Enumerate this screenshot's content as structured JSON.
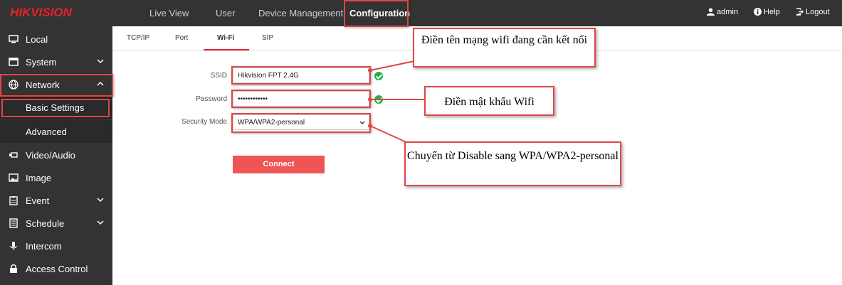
{
  "brand": {
    "logo_text": "HIKVISION",
    "accent": "#e6212a"
  },
  "topnav": {
    "items": [
      {
        "label": "Live View"
      },
      {
        "label": "User"
      },
      {
        "label": "Device Management"
      },
      {
        "label": "Configuration",
        "active": true
      }
    ],
    "right": [
      {
        "label": "admin",
        "icon": "user-icon"
      },
      {
        "label": "Help",
        "icon": "info-icon"
      },
      {
        "label": "Logout",
        "icon": "logout-icon"
      }
    ]
  },
  "sidebar": {
    "items": [
      {
        "label": "Local",
        "icon": "monitor-icon"
      },
      {
        "label": "System",
        "icon": "window-icon"
      },
      {
        "label": "Network",
        "icon": "globe-icon",
        "expanded": true
      },
      {
        "label": "Basic Settings",
        "sub": true,
        "selected": true
      },
      {
        "label": "Advanced",
        "sub": true
      },
      {
        "label": "Video/Audio",
        "icon": "camera-icon"
      },
      {
        "label": "Image",
        "icon": "image-icon"
      },
      {
        "label": "Event",
        "icon": "clipboard-icon"
      },
      {
        "label": "Schedule",
        "icon": "schedule-icon"
      },
      {
        "label": "Intercom",
        "icon": "mic-icon"
      },
      {
        "label": "Access Control",
        "icon": "lock-icon"
      }
    ]
  },
  "tabs": [
    "TCP/IP",
    "Port",
    "Wi-Fi",
    "SIP"
  ],
  "active_tab": "Wi-Fi",
  "form": {
    "ssid_label": "SSID",
    "ssid_value": "Hikvision FPT 2.4G",
    "password_label": "Password",
    "password_value": "••••••••••••",
    "security_label": "Security Mode",
    "security_value": "WPA/WPA2-personal",
    "connect_label": "Connect"
  },
  "callouts": {
    "ssid_note": "Điền tên mạng wifi đang cần kết nối",
    "password_note": "Điền mật khẩu Wifi",
    "security_note": "Chuyển từ Disable sang WPA/WPA2-personal"
  },
  "colors": {
    "topbar": "#333333",
    "highlight": "#e04646",
    "button": "#f05454",
    "ok": "#21b14a"
  }
}
